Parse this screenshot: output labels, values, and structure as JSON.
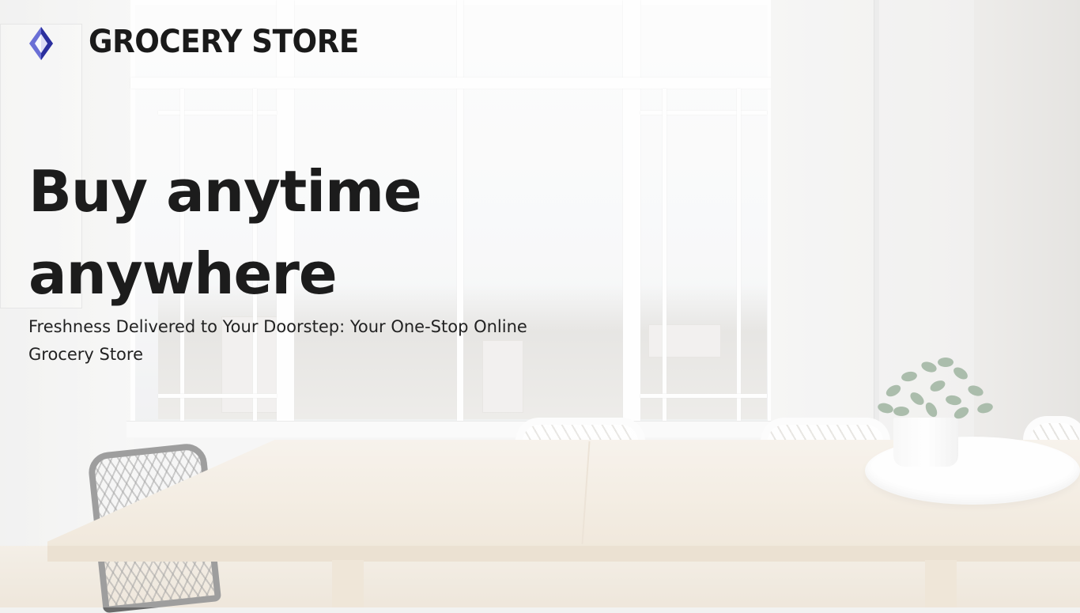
{
  "brand": {
    "name": "GROCERY STORE",
    "logo_icon": "diamond-logo-icon",
    "colors": {
      "logo_light": "#6a6fd6",
      "logo_dark": "#2b2f9e"
    }
  },
  "hero": {
    "headline_line1": "Buy anytime",
    "headline_line2": "anywhere",
    "tagline_line1": "Freshness Delivered to Your Doorstep: Your One-Stop Online",
    "tagline_line2": "Grocery Store"
  },
  "background": {
    "description_icon": "dining-room-photo"
  }
}
